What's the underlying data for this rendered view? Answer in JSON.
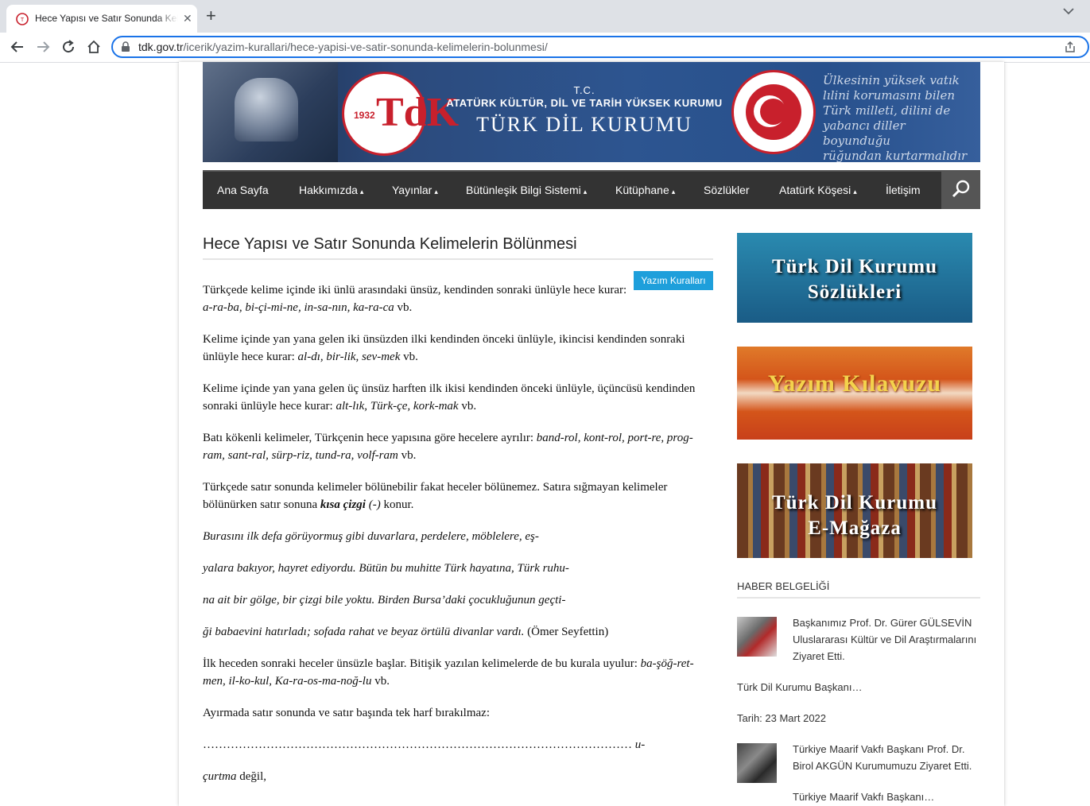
{
  "browser": {
    "tab_title": "Hece Yapısı ve Satır Sonunda Kelimelerin Bölünmesi",
    "url_host": "tdk.gov.tr",
    "url_path": "/icerik/yazim-kurallari/hece-yapisi-ve-satir-sonunda-kelimelerin-bolunmesi/"
  },
  "banner": {
    "tc": "T.C.",
    "org_line": "ATATÜRK KÜLTÜR, DİL VE TARİH YÜKSEK KURUMU",
    "org_name": "TÜRK DİL KURUMU",
    "logo_year": "1932",
    "logo_letters": "TdK",
    "script_lines": [
      "Ülkesinin yüksek vatık",
      "lılini korumasını bilen",
      "Türk milleti, dilini de",
      "yabancı diller boyunduğu",
      "rüğundan kurtarmalıdır"
    ]
  },
  "nav": {
    "items": [
      {
        "label": "Ana Sayfa",
        "caret": ""
      },
      {
        "label": "Hakkımızda",
        "caret": "▴"
      },
      {
        "label": "Yayınlar",
        "caret": "▴"
      },
      {
        "label": "Bütünleşik Bilgi Sistemi",
        "caret": "▴"
      },
      {
        "label": "Kütüphane",
        "caret": "▴"
      },
      {
        "label": "Sözlükler",
        "caret": ""
      },
      {
        "label": "Atatürk Köşesi",
        "caret": "▴"
      },
      {
        "label": "İletişim",
        "caret": ""
      }
    ]
  },
  "article": {
    "title": "Hece Yapısı ve Satır Sonunda Kelimelerin Bölünmesi",
    "category": "Yazım Kuralları",
    "p1_text": "Türkçede kelime içinde iki ünlü arasındaki ünsüz, kendinden sonraki ünlüyle hece kurar: ",
    "p1_ex": "a-ra-ba, bi-çi-mi-ne, in-sa-nın, ka-ra-ca",
    "p2_text": "Kelime içinde yan yana gelen iki ünsüzden ilki kendinden önceki ünlüyle, ikincisi kendinden sonraki ünlüyle hece kurar: ",
    "p2_ex": "al-dı, bir-lik, sev-mek",
    "p3_text": "Kelime içinde yan yana gelen üç ünsüz harften ilk ikisi kendinden önceki ünlüyle, üçüncüsü kendinden sonraki ünlüyle hece kurar: ",
    "p3_ex": "alt-lık, Türk-çe, kork-mak",
    "p4_text": "Batı kökenli kelimeler, Türkçenin hece yapısına göre hecelere ayrılır: ",
    "p4_ex": "band-rol, kont-rol, port-re, prog-ram, sant-ral, sürp-riz, tund-ra, volf-ram",
    "vb": " vb.",
    "p5_text": "Türkçede satır sonunda kelimeler bölünebilir fakat heceler bölünemez. Satıra sığmayan kelimeler bölünürken satır sonuna ",
    "p5_bold": "kısa çizgi",
    "p5_dash": " (-)",
    "p5_end": " konur.",
    "q1": "Burasını ilk defa görüyormuş gibi duvarlara, perdelere, möblelere, eş-",
    "q2": "yalara bakıyor, hayret ediyordu. Bütün bu muhitte Türk hayatına, Türk ruhu-",
    "q3": "na ait bir gölge, bir çizgi bile yoktu. Birden Bursa’daki çocukluğunun geçti-",
    "q4": "ği babaevini hatırladı; sofada rahat ve beyaz örtülü divanlar vardı.",
    "q4_src": " (Ömer Seyfettin)",
    "p6_text": "İlk heceden sonraki heceler ünsüzle başlar. Bitişik yazılan kelimelerde de bu kurala uyulur: ",
    "p6_ex": "ba-şöğ-ret-men, il-ko-kul, Ka-ra-os-ma-noğ-lu",
    "p7_text": "Ayırmada satır sonunda ve satır başında tek harf bırakılmaz:",
    "dots": "………………………………………………………………………………………………",
    "dots_end": " u-",
    "p8_ex": "çurtma",
    "p8_text": " değil,"
  },
  "sidebar": {
    "ad1": {
      "line1": "Türk Dil Kurumu",
      "line2": "Sözlükleri"
    },
    "ad2": {
      "line1": "Yazım Kılavuzu"
    },
    "ad3": {
      "line1": "Türk Dil Kurumu",
      "line2": "E-Mağaza"
    },
    "news_heading": "HABER BELGELİĞİ",
    "news": [
      {
        "title": "Başkanımız Prof. Dr. Gürer GÜLSEVİN Uluslararası Kültür ve Dil Araştırmalarını Ziyaret Etti.",
        "excerpt": "Türk Dil Kurumu Başkanı…",
        "date": "Tarih: 23 Mart 2022"
      },
      {
        "title": "Türkiye Maarif Vakfı Başkanı Prof. Dr. Birol AKGÜN Kurumumuzu Ziyaret Etti.",
        "excerpt": "Türkiye Maarif Vakfı Başkanı…"
      }
    ]
  },
  "colors": {
    "accent": "#1e9fdb",
    "nav_bg": "#333333",
    "brand_red": "#c8202c"
  }
}
